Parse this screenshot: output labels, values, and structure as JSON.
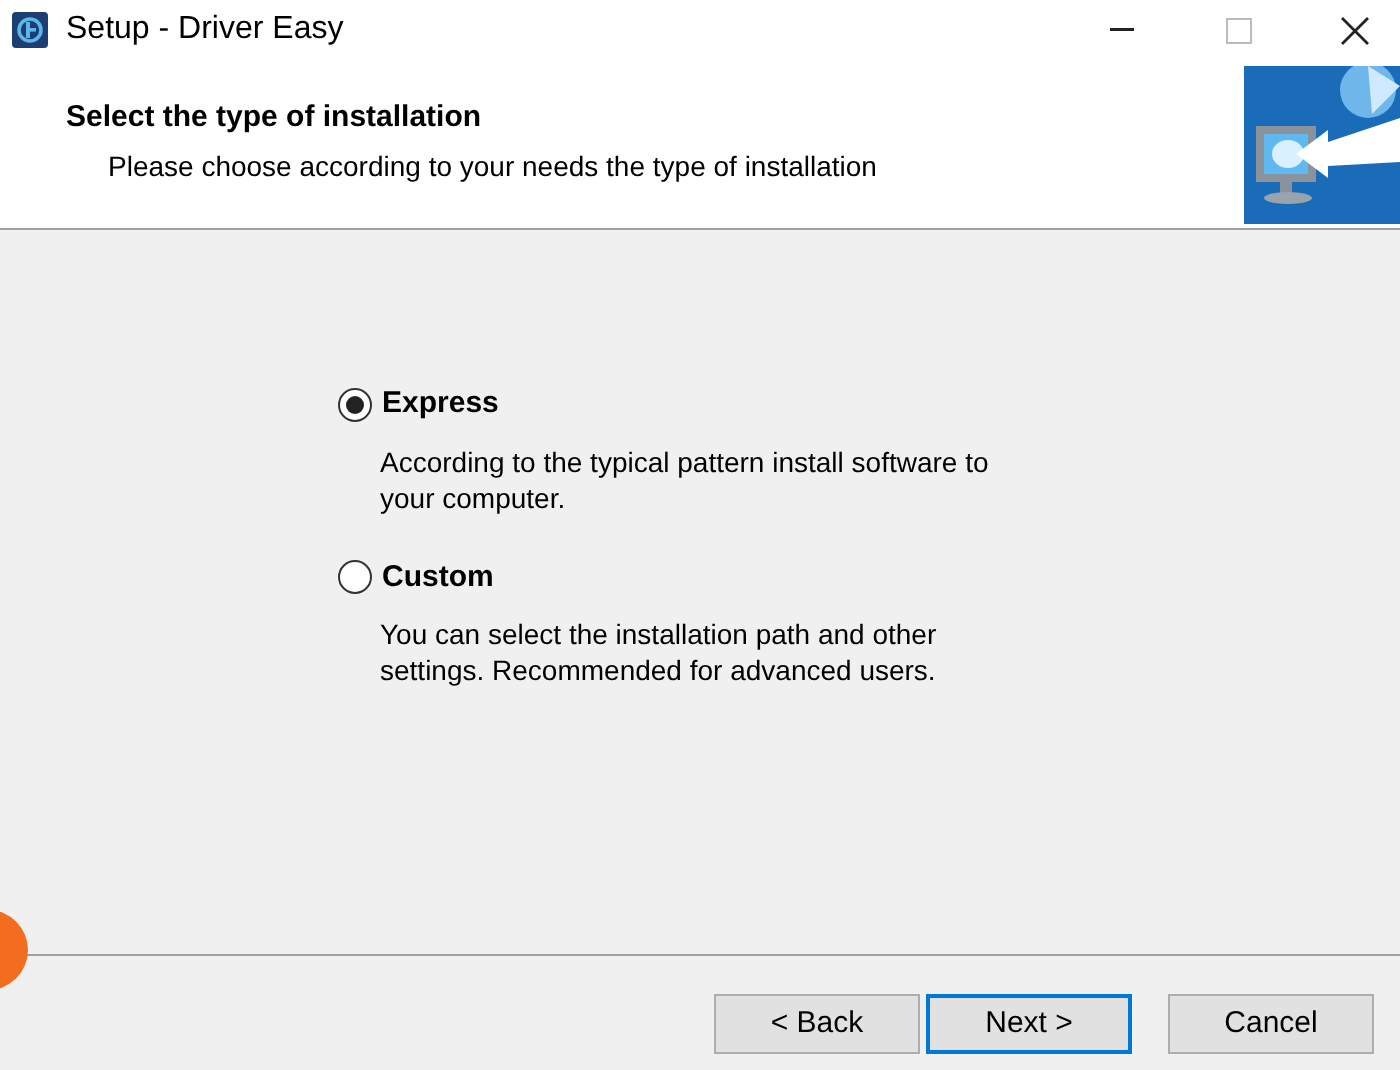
{
  "window": {
    "title": "Setup - Driver Easy"
  },
  "header": {
    "title": "Select the type of installation",
    "subtitle": "Please choose according to your needs the type of installation"
  },
  "options": [
    {
      "label": "Express",
      "description": "According to the typical pattern install software to your computer.",
      "selected": true
    },
    {
      "label": "Custom",
      "description": "You can select the installation path and other settings. Recommended for advanced users.",
      "selected": false
    }
  ],
  "buttons": [
    {
      "label": "< Back",
      "default": false
    },
    {
      "label": "Next >",
      "default": true
    },
    {
      "label": "Cancel",
      "default": false
    }
  ]
}
